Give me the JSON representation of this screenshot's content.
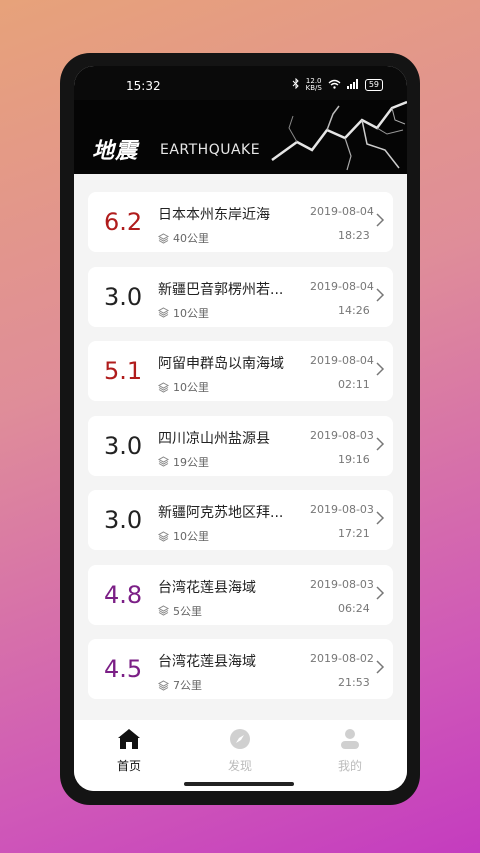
{
  "status": {
    "time": "15:32",
    "speed_top": "12.0",
    "speed_bottom": "KB/S",
    "battery": "59"
  },
  "banner": {
    "title_zh": "地震",
    "title_en": "EARTHQUAKE"
  },
  "colors": {
    "strong": "#b01c1c",
    "mid": "#7b1f86",
    "normal": "#222222"
  },
  "quakes": [
    {
      "mag": "6.2",
      "place": "日本本州东岸近海",
      "depth": "40公里",
      "date": "2019-08-04",
      "time": "18:23",
      "level": "strong"
    },
    {
      "mag": "3.0",
      "place": "新疆巴音郭楞州若...",
      "depth": "10公里",
      "date": "2019-08-04",
      "time": "14:26",
      "level": "normal"
    },
    {
      "mag": "5.1",
      "place": "阿留申群岛以南海域",
      "depth": "10公里",
      "date": "2019-08-04",
      "time": "02:11",
      "level": "strong"
    },
    {
      "mag": "3.0",
      "place": "四川凉山州盐源县",
      "depth": "19公里",
      "date": "2019-08-03",
      "time": "19:16",
      "level": "normal"
    },
    {
      "mag": "3.0",
      "place": "新疆阿克苏地区拜...",
      "depth": "10公里",
      "date": "2019-08-03",
      "time": "17:21",
      "level": "normal"
    },
    {
      "mag": "4.8",
      "place": "台湾花莲县海域",
      "depth": "5公里",
      "date": "2019-08-03",
      "time": "06:24",
      "level": "mid"
    },
    {
      "mag": "4.5",
      "place": "台湾花莲县海域",
      "depth": "7公里",
      "date": "2019-08-02",
      "time": "21:53",
      "level": "mid"
    }
  ],
  "tabs": [
    {
      "label": "首页",
      "icon": "home-icon",
      "active": true
    },
    {
      "label": "发现",
      "icon": "compass-icon",
      "active": false
    },
    {
      "label": "我的",
      "icon": "user-icon",
      "active": false
    }
  ]
}
